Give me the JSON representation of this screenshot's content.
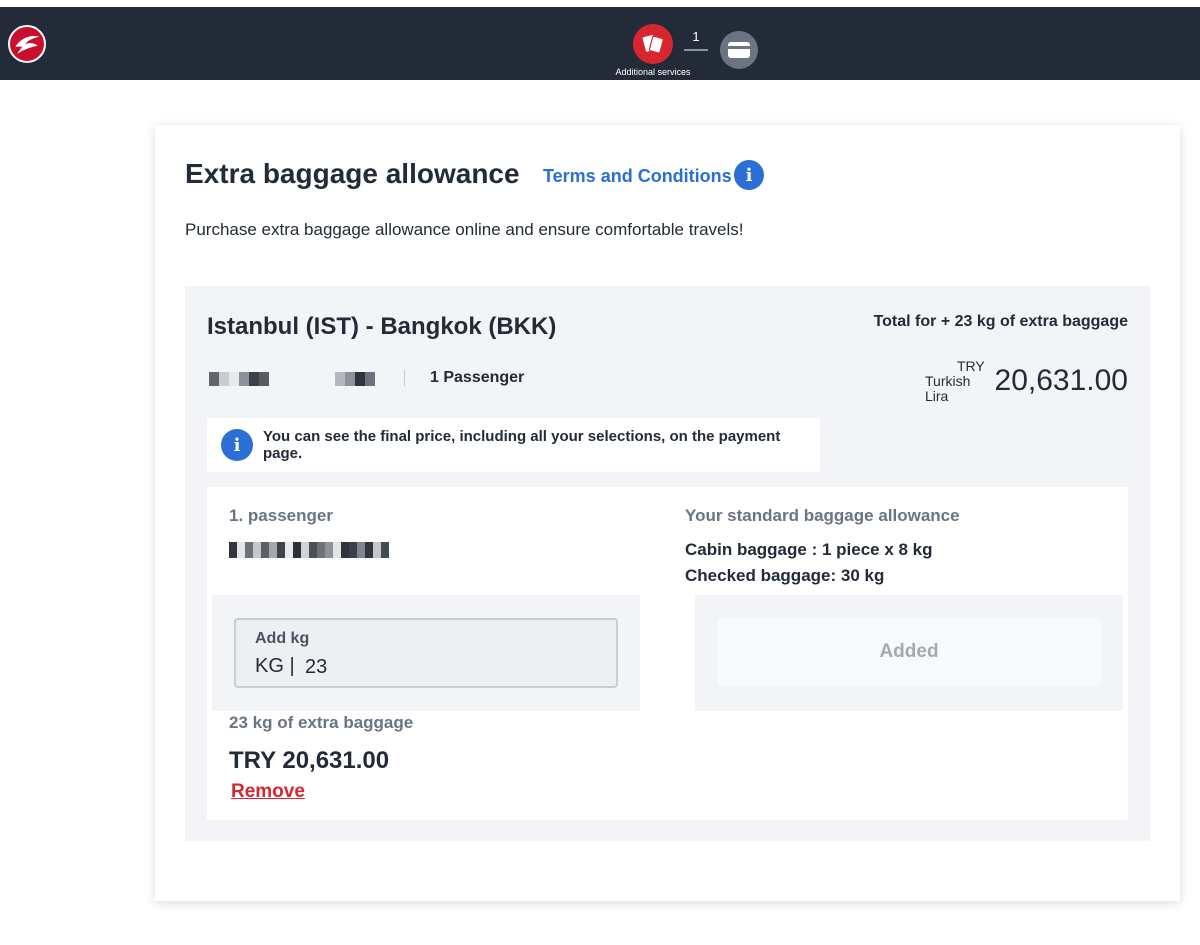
{
  "header": {
    "logo_icon": "turkish-airlines-logo",
    "steps": [
      {
        "icon": "additional-services-icon",
        "label": "Additional services",
        "count": "1",
        "active": true
      },
      {
        "icon": "payment-card-icon",
        "active": false
      }
    ],
    "colors": {
      "bar": "#232b38",
      "active_step": "#d7262e",
      "inactive_step": "#6b7482"
    }
  },
  "card": {
    "title": "Extra baggage allowance",
    "terms_link": "Terms and Conditions",
    "info_icon": "info-icon",
    "subtitle": "Purchase extra baggage allowance online and ensure comfortable travels!"
  },
  "route": {
    "title": "Istanbul (IST) - Bangkok (BKK)",
    "passengers": "1 Passenger",
    "total_label": "Total for + 23 kg of extra baggage",
    "currency_code": "TRY",
    "currency_name": "Turkish Lira",
    "total_amount": "20,631.00",
    "notice": "You can see the final price, including all your selections, on the payment page."
  },
  "passenger": {
    "label": "1. passenger",
    "add_kg_label": "Add kg",
    "kg_prefix": "KG |",
    "kg_value": "23",
    "standard_title": "Your standard baggage allowance",
    "cabin": "Cabin baggage : 1 piece x 8 kg",
    "checked": "Checked baggage: 30 kg",
    "added_button": "Added",
    "extra_label": "23 kg of extra baggage",
    "extra_price": "TRY 20,631.00",
    "remove_link": "Remove"
  },
  "colors": {
    "link": "#2b6ed6",
    "danger": "#d7262e",
    "text": "#232b38",
    "muted": "#6b7482"
  }
}
